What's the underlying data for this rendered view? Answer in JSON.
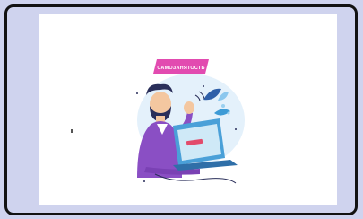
{
  "illustration": {
    "badge_text": "САМОЗАНЯТОСТЬ",
    "icon": "man-at-laptop-illustration"
  },
  "colors": {
    "background": "#cfd3ee",
    "frame_border": "#121212",
    "content": "#ffffff",
    "badge": "#e24bb0",
    "shirt": "#8a4fc4",
    "laptop": "#4aa0d8",
    "screen": "#cfe9f7",
    "accent_button": "#e24b6b"
  }
}
